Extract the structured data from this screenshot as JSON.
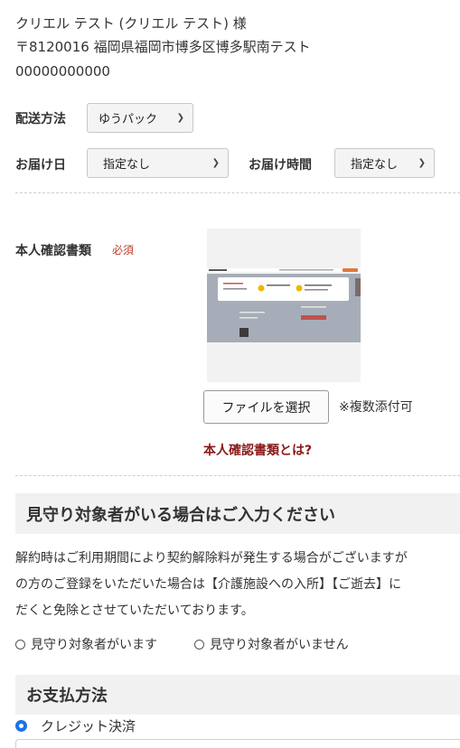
{
  "address": {
    "name_line": "クリエル テスト (クリエル テスト) 様",
    "postal_line": "〒8120016 福岡県福岡市博多区博多駅南テスト",
    "phone_line": "00000000000"
  },
  "shipping": {
    "method_label": "配送方法",
    "method_value": "ゆうパック",
    "date_label": "お届け日",
    "date_value": "指定なし",
    "time_label": "お届け時間",
    "time_value": "指定なし"
  },
  "identity": {
    "label": "本人確認書類",
    "required": "必須",
    "file_button": "ファイルを選択",
    "multiple_note": "※複数添付可",
    "what_link": "本人確認書類とは?"
  },
  "guardian": {
    "heading": "見守り対象者がいる場合はご入力ください",
    "text_line1": "解約時はご利用期間により契約解除料が発生する場合がございますが",
    "text_line2": "の方のご登録をいただいた場合は【介護施設への入所】【ご逝去】に",
    "text_line3": "だくと免除とさせていただいております。",
    "option_yes": "見守り対象者がいます",
    "option_no": "見守り対象者がいません"
  },
  "payment": {
    "heading": "お支払方法",
    "option_credit": "クレジット決済",
    "selected": "クレジット決済"
  },
  "colors": {
    "required": "#c0392b",
    "link": "#8b1a1a",
    "radio_selected": "#1a73e8",
    "section_bg": "#f1f1f1"
  }
}
